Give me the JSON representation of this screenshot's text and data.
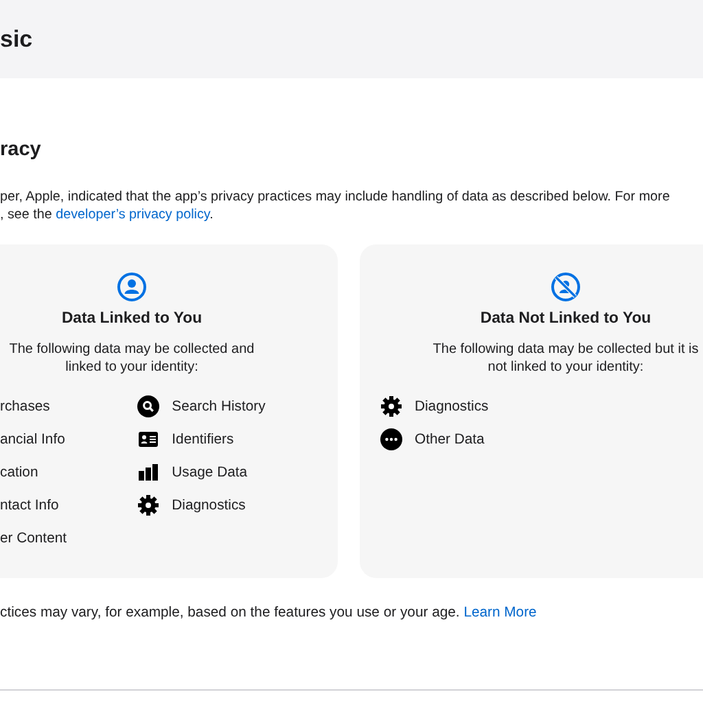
{
  "header": {
    "title": "sic"
  },
  "section": {
    "title": "racy",
    "description": "per, Apple, indicated that the app’s privacy practices may include handling of data as described below. For more",
    "description_line2": ", see the ",
    "policy_link": "developer’s privacy policy",
    "description_end": "."
  },
  "cards": [
    {
      "kind": "linked",
      "title": "Data Linked to You",
      "text": "The following data may be collected and linked to your identity:",
      "columns": [
        [
          {
            "label": "rchases"
          },
          {
            "label": "ancial Info"
          },
          {
            "label": "cation"
          },
          {
            "label": "ntact Info"
          },
          {
            "label": "er Content"
          }
        ],
        [
          {
            "label": "Search History",
            "kind": "search"
          },
          {
            "label": "Identifiers",
            "kind": "id"
          },
          {
            "label": "Usage Data",
            "kind": "bars"
          },
          {
            "label": "Diagnostics",
            "kind": "gear"
          }
        ]
      ]
    },
    {
      "kind": "not-linked",
      "title": "Data Not Linked to You",
      "text": "The following data may be collected but it is not linked to your identity:",
      "columns": [
        [
          {
            "label": "Diagnostics",
            "kind": "gear"
          },
          {
            "label": "Other Data",
            "kind": "dots"
          }
        ]
      ]
    }
  ],
  "footer": {
    "text": "ctices may vary, for example, based on the features you use or your age.",
    "link": "Learn More"
  }
}
